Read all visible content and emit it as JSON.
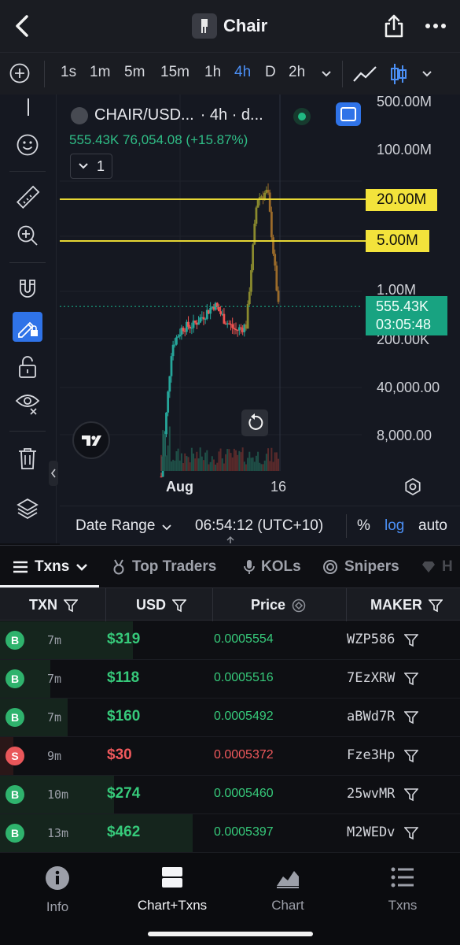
{
  "header": {
    "title": "Chair",
    "back_icon": "chevron-left-icon",
    "share_icon": "share-icon",
    "more_icon": "more-icon"
  },
  "timeframes": {
    "items": [
      "1s",
      "1m",
      "5m",
      "15m",
      "1h",
      "4h",
      "D",
      "2h"
    ],
    "active": "4h"
  },
  "chart": {
    "pair": "CHAIR/USD...",
    "interval": "· 4h · d...",
    "stats": "555.43K  76,054.08 (+15.87%)",
    "indicators_count": "1",
    "y_ticks": [
      "500.00M",
      "100.00M",
      "1.00M",
      "200.00K",
      "40,000.00",
      "8,000.00"
    ],
    "alert_lines": [
      "20.00M",
      "5.00M"
    ],
    "current_price": "555.43K",
    "countdown": "03:05:48",
    "x_labels": [
      "Aug",
      "16"
    ],
    "date_range": "Date Range",
    "time": "06:54:12 (UTC+10)",
    "pct": "%",
    "log": "log",
    "auto": "auto",
    "colors": {
      "up": "#26a69a",
      "down": "#ef5350",
      "alert": "#f3e33b",
      "accent": "#2f73e8"
    }
  },
  "chart_data": {
    "type": "candlestick",
    "y_scale": "log",
    "x_labels": [
      "Aug",
      "16"
    ],
    "close_approx": [
      2000,
      150000,
      280000,
      300000,
      420000,
      600000,
      350000,
      250000,
      300000,
      20000000,
      25000000,
      555430
    ],
    "current": 555430
  },
  "tabs": [
    {
      "label": "Txns",
      "icon": "list-icon",
      "active": true
    },
    {
      "label": "Top Traders",
      "icon": "medal-icon"
    },
    {
      "label": "KOLs",
      "icon": "mic-icon"
    },
    {
      "label": "Snipers",
      "icon": "target-icon"
    },
    {
      "label": "H",
      "icon": "diamond-icon"
    }
  ],
  "table": {
    "headers": {
      "txn": "TXN",
      "usd": "USD",
      "price": "Price",
      "maker": "MAKER"
    },
    "rows": [
      {
        "side": "B",
        "age": "7m",
        "usd": "$319",
        "price": "0.0005554",
        "maker": "WZP586",
        "fill": 0.69
      },
      {
        "side": "B",
        "age": "7m",
        "usd": "$118",
        "price": "0.0005516",
        "maker": "7EzXRW",
        "fill": 0.26
      },
      {
        "side": "B",
        "age": "7m",
        "usd": "$160",
        "price": "0.0005492",
        "maker": "aBWd7R",
        "fill": 0.35
      },
      {
        "side": "S",
        "age": "9m",
        "usd": "$30",
        "price": "0.0005372",
        "maker": "Fze3Hp",
        "fill": 0.07
      },
      {
        "side": "B",
        "age": "10m",
        "usd": "$274",
        "price": "0.0005460",
        "maker": "25wvMR",
        "fill": 0.59
      },
      {
        "side": "B",
        "age": "13m",
        "usd": "$462",
        "price": "0.0005397",
        "maker": "M2WEDv",
        "fill": 1.0
      }
    ]
  },
  "bottom_nav": [
    {
      "label": "Info",
      "icon": "info-icon"
    },
    {
      "label": "Chart+Txns",
      "icon": "split-view-icon",
      "active": true
    },
    {
      "label": "Chart",
      "icon": "area-chart-icon"
    },
    {
      "label": "Txns",
      "icon": "list-icon"
    }
  ]
}
